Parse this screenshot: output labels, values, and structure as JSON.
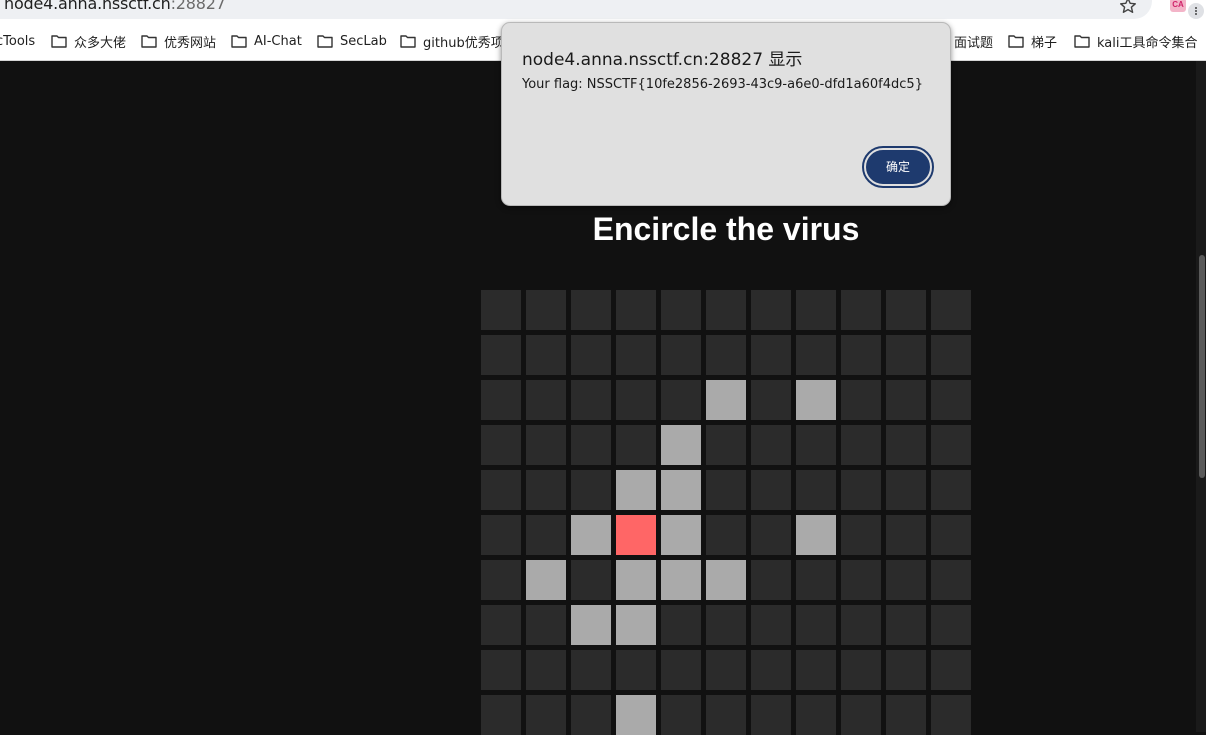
{
  "browser": {
    "url_host": "node4.anna.nssctf.cn",
    "url_port": ":28827",
    "bookmarks": [
      {
        "label": "cTools"
      },
      {
        "label": "众多大佬"
      },
      {
        "label": "优秀网站"
      },
      {
        "label": "AI-Chat"
      },
      {
        "label": "SecLab"
      },
      {
        "label": "github优秀项目"
      },
      {
        "label": "面试题"
      },
      {
        "label": "梯子"
      },
      {
        "label": "kali工具命令集合"
      }
    ],
    "extension_label": "CA"
  },
  "dialog": {
    "title": "node4.anna.nssctf.cn:28827 显示",
    "message": "Your flag: NSSCTF{10fe2856-2693-43c9-a6e0-dfd1a60f4dc5}",
    "ok_label": "确定"
  },
  "page": {
    "title": "Encircle the virus"
  },
  "game": {
    "columns": 11,
    "visible_rows": 10,
    "virus_cell": [
      5,
      3
    ],
    "wall_cells": [
      [
        2,
        5
      ],
      [
        2,
        7
      ],
      [
        3,
        4
      ],
      [
        4,
        3
      ],
      [
        4,
        4
      ],
      [
        5,
        2
      ],
      [
        5,
        4
      ],
      [
        5,
        7
      ],
      [
        6,
        1
      ],
      [
        6,
        3
      ],
      [
        6,
        4
      ],
      [
        6,
        5
      ],
      [
        7,
        2
      ],
      [
        7,
        3
      ],
      [
        9,
        3
      ]
    ],
    "colors": {
      "empty": "#2b2b2b",
      "wall": "#aaaaaa",
      "virus": "#ff6666",
      "background": "#111111"
    }
  }
}
